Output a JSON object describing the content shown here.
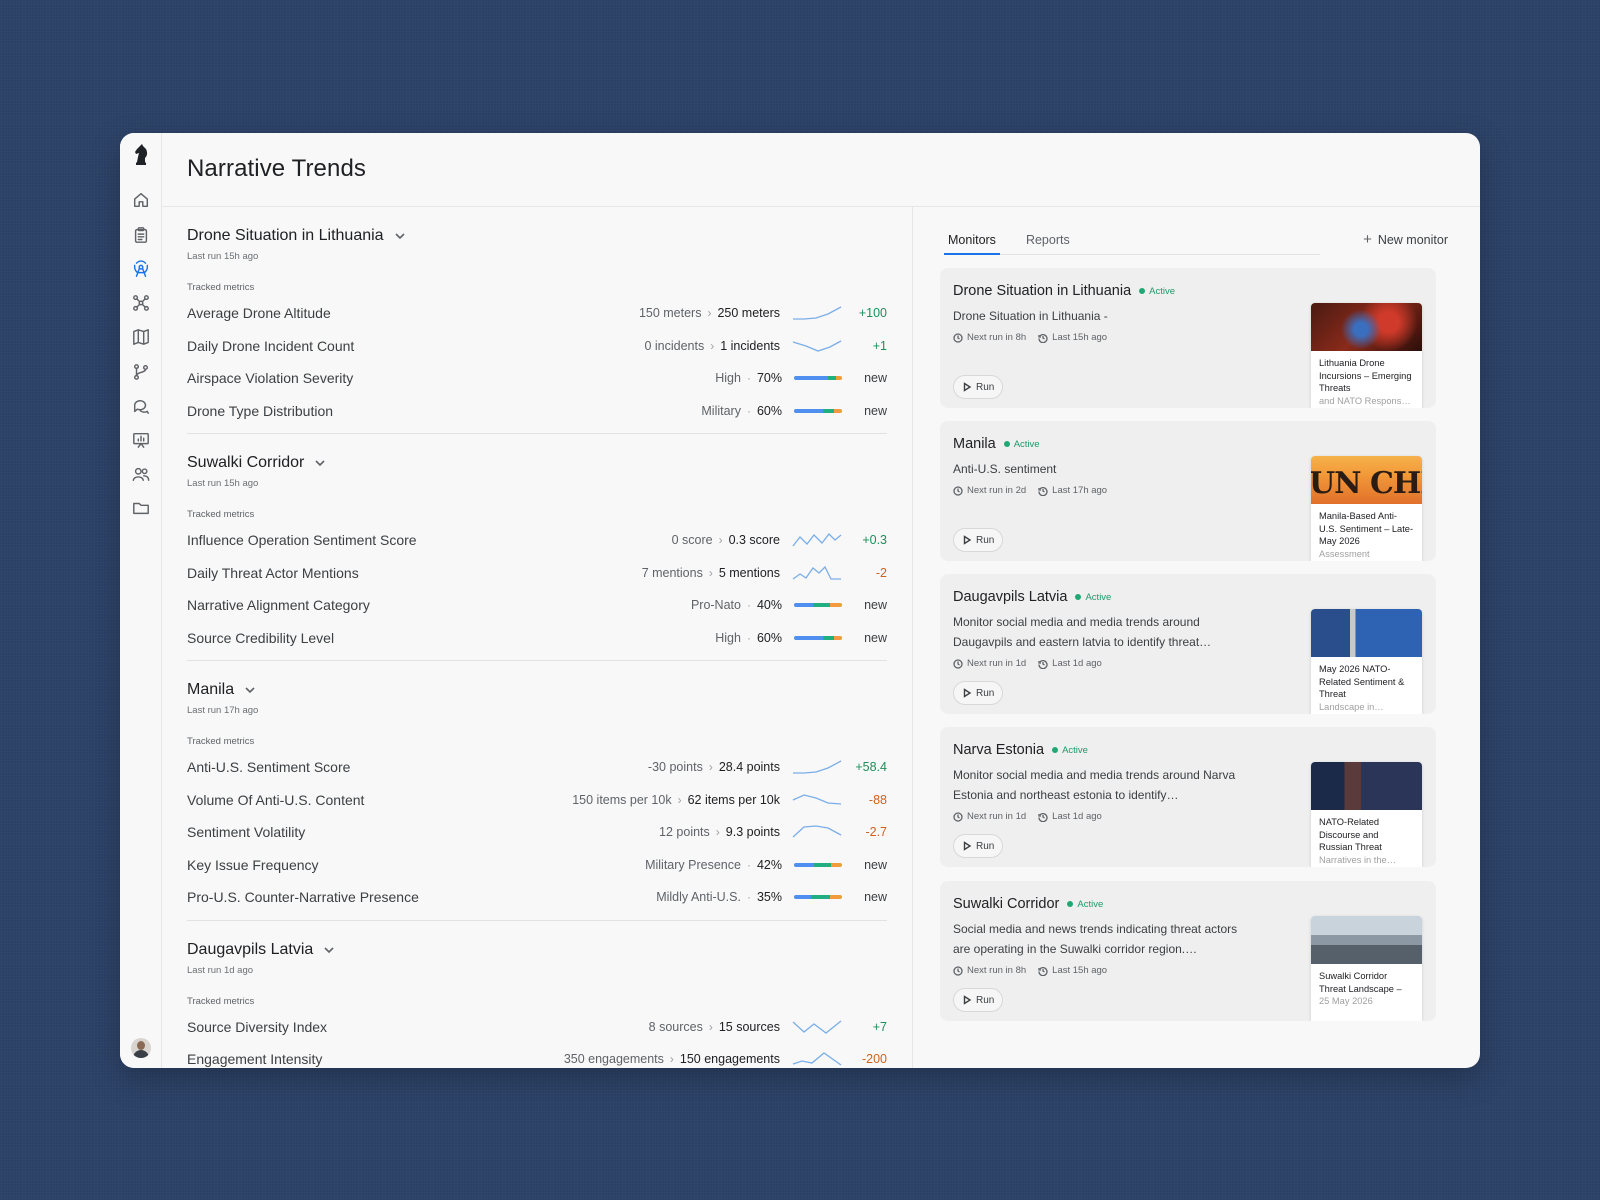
{
  "page": {
    "title": "Narrative Trends"
  },
  "rail": {
    "items": [
      "home-icon",
      "clipboard-icon",
      "broadcast-icon",
      "graph-icon",
      "map-icon",
      "branch-icon",
      "chat-icon",
      "presentation-icon",
      "people-icon",
      "folder-icon"
    ],
    "active": "broadcast-icon"
  },
  "trends": {
    "groups": [
      {
        "title": "Drone Situation in Lithuania",
        "last_run": "Last run 15h ago",
        "metrics_label": "Tracked metrics",
        "metrics": [
          {
            "name": "Average Drone Altitude",
            "from": "150 meters",
            "to": "250 meters",
            "delta": "+100",
            "trend": "up"
          },
          {
            "name": "Daily Drone Incident Count",
            "from": "0 incidents",
            "to": "1 incidents",
            "delta": "+1",
            "trend": "valley"
          },
          {
            "name": "Airspace Violation Severity",
            "category": "High",
            "share": "70%",
            "delta": "new"
          },
          {
            "name": "Drone Type Distribution",
            "category": "Military",
            "share": "60%",
            "delta": "new"
          }
        ]
      },
      {
        "title": "Suwalki Corridor",
        "last_run": "Last run 15h ago",
        "metrics_label": "Tracked metrics",
        "metrics": [
          {
            "name": "Influence Operation Sentiment Score",
            "from": "0 score",
            "to": "0.3 score",
            "delta": "+0.3",
            "trend": "zigzag-up"
          },
          {
            "name": "Daily Threat Actor Mentions",
            "from": "7 mentions",
            "to": "5 mentions",
            "delta": "-2",
            "trend": "zigzag-down"
          },
          {
            "name": "Narrative Alignment Category",
            "category": "Pro-Nato",
            "share": "40%",
            "delta": "new"
          },
          {
            "name": "Source Credibility Level",
            "category": "High",
            "share": "60%",
            "delta": "new"
          }
        ]
      },
      {
        "title": "Manila",
        "last_run": "Last run 17h ago",
        "metrics_label": "Tracked metrics",
        "metrics": [
          {
            "name": "Anti-U.S. Sentiment Score",
            "from": "-30 points",
            "to": "28.4 points",
            "delta": "+58.4",
            "trend": "up"
          },
          {
            "name": "Volume Of Anti-U.S. Content",
            "from": "150 items per 10k",
            "to": "62 items per 10k",
            "delta": "-88",
            "trend": "hump-down"
          },
          {
            "name": "Sentiment Volatility",
            "from": "12 points",
            "to": "9.3 points",
            "delta": "-2.7",
            "trend": "plateau"
          },
          {
            "name": "Key Issue Frequency",
            "category": "Military Presence",
            "share": "42%",
            "delta": "new"
          },
          {
            "name": "Pro-U.S. Counter-Narrative Presence",
            "category": "Mildly Anti-U.S.",
            "share": "35%",
            "delta": "new"
          }
        ]
      },
      {
        "title": "Daugavpils Latvia",
        "last_run": "Last run 1d ago",
        "metrics_label": "Tracked metrics",
        "metrics": [
          {
            "name": "Source Diversity Index",
            "from": "8 sources",
            "to": "15 sources",
            "delta": "+7",
            "trend": "w"
          },
          {
            "name": "Engagement Intensity",
            "from": "350 engagements",
            "to": "150 engagements",
            "delta": "-200",
            "trend": "peak"
          }
        ]
      }
    ]
  },
  "monitors": {
    "tabs": [
      "Monitors",
      "Reports"
    ],
    "active_tab": "Monitors",
    "new_label": "New monitor",
    "run_label": "Run",
    "cards": [
      {
        "title": "Drone Situation in Lithuania",
        "status": "Active",
        "desc": "Drone Situation in Lithuania -",
        "next": "Next run in 8h",
        "last": "Last 15h ago",
        "report": {
          "title": "Lithuania Drone Incursions – Emerging Threats",
          "fade": "and NATO Respons…"
        }
      },
      {
        "title": "Manila",
        "status": "Active",
        "desc": "Anti-U.S. sentiment",
        "next": "Next run in 2d",
        "last": "Last 17h ago",
        "report": {
          "title": "Manila-Based Anti-U.S. Sentiment – Late-May 2026",
          "fade": "Assessment",
          "banner": "UN CHRO"
        }
      },
      {
        "title": "Daugavpils Latvia",
        "status": "Active",
        "desc": "Monitor social media and media trends around Daugavpils and eastern latvia to identify threat…",
        "next": "Next run in 1d",
        "last": "Last 1d ago",
        "report": {
          "title": "May 2026 NATO-Related Sentiment & Threat",
          "fade": "Landscape in…"
        }
      },
      {
        "title": "Narva Estonia",
        "status": "Active",
        "desc": "Monitor social media and media trends around Narva Estonia and northeast estonia to identify…",
        "next": "Next run in 1d",
        "last": "Last 1d ago",
        "report": {
          "title": "NATO-Related Discourse and Russian Threat",
          "fade": "Narratives in the…"
        }
      },
      {
        "title": "Suwalki Corridor",
        "status": "Active",
        "desc": "Social media and news trends indicating threat actors are operating in the Suwalki corridor region.…",
        "next": "Next run in 8h",
        "last": "Last 15h ago",
        "report": {
          "title": "Suwalki Corridor Threat Landscape –",
          "fade": "25 May 2026"
        }
      }
    ]
  },
  "colors": {
    "accent": "#1a73e8",
    "positive": "#1e8e5a",
    "negative": "#d0621c",
    "active": "#20a874"
  }
}
